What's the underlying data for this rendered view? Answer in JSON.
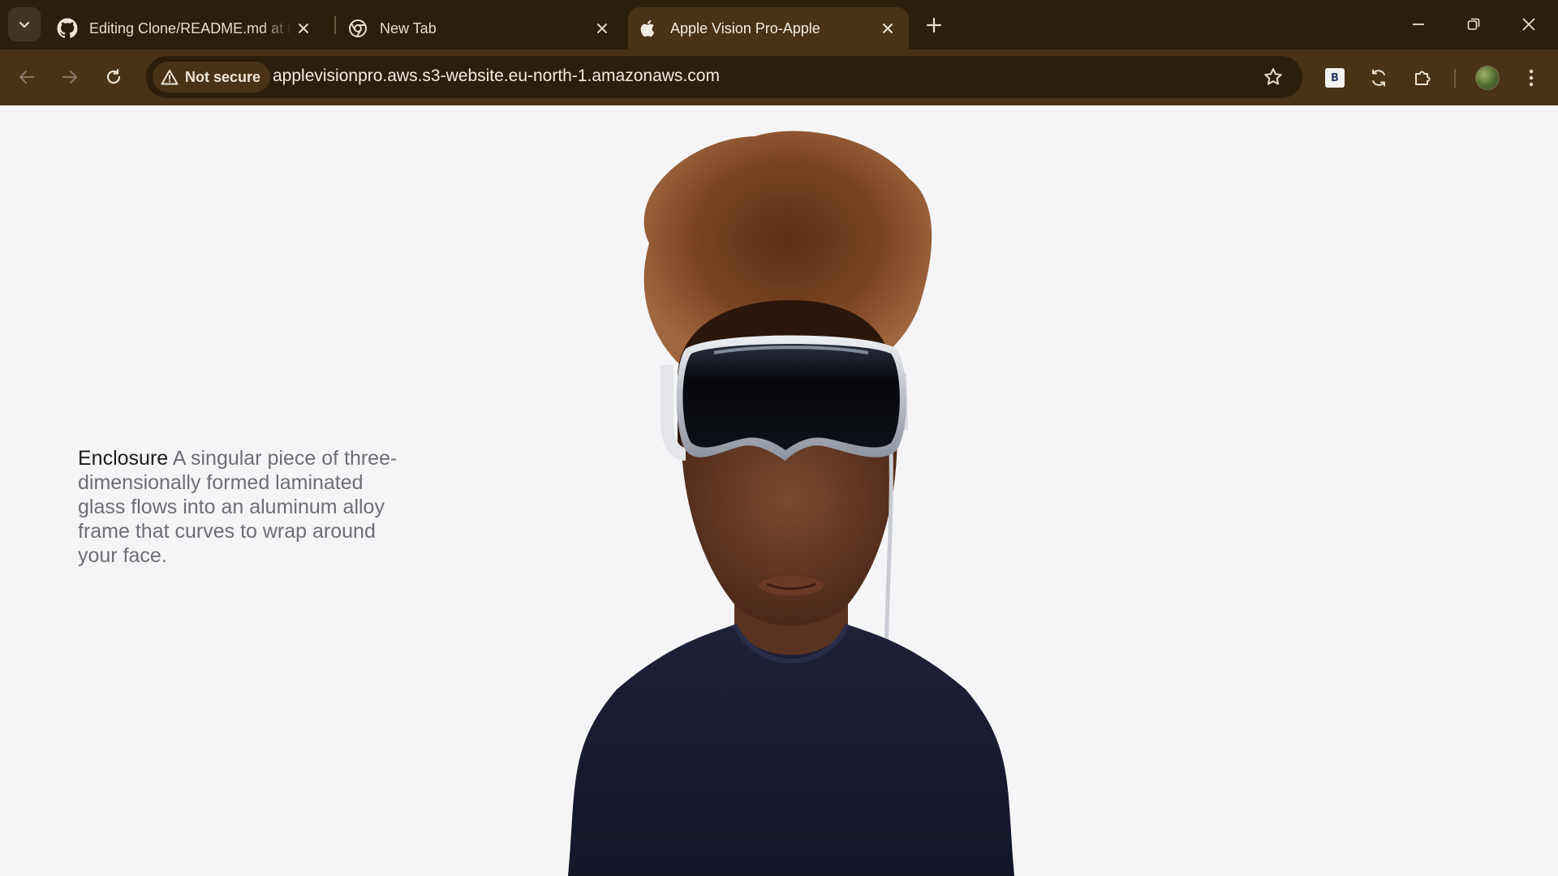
{
  "tabs": [
    {
      "title": "Editing Clone/README.md at main",
      "icon": "github-icon",
      "active": false
    },
    {
      "title": "New Tab",
      "icon": "chrome-icon",
      "active": false
    },
    {
      "title": "Apple Vision Pro-Apple",
      "icon": "apple-icon",
      "active": true
    }
  ],
  "address_bar": {
    "security_label": "Not secure",
    "url": "applevisionpro.aws.s3-website.eu-north-1.amazonaws.com"
  },
  "extensions": {
    "b_label": "B"
  },
  "page": {
    "caption_lead": "Enclosure",
    "caption_body": "A singular piece of three-dimensionally formed laminated glass flows into an aluminum alloy frame that curves to wrap around your face."
  },
  "colors": {
    "tabstrip": "#2d1e0c",
    "toolbar": "#4a3217",
    "page_background": "#f5f5f7",
    "sweater": "#1a1c33"
  }
}
